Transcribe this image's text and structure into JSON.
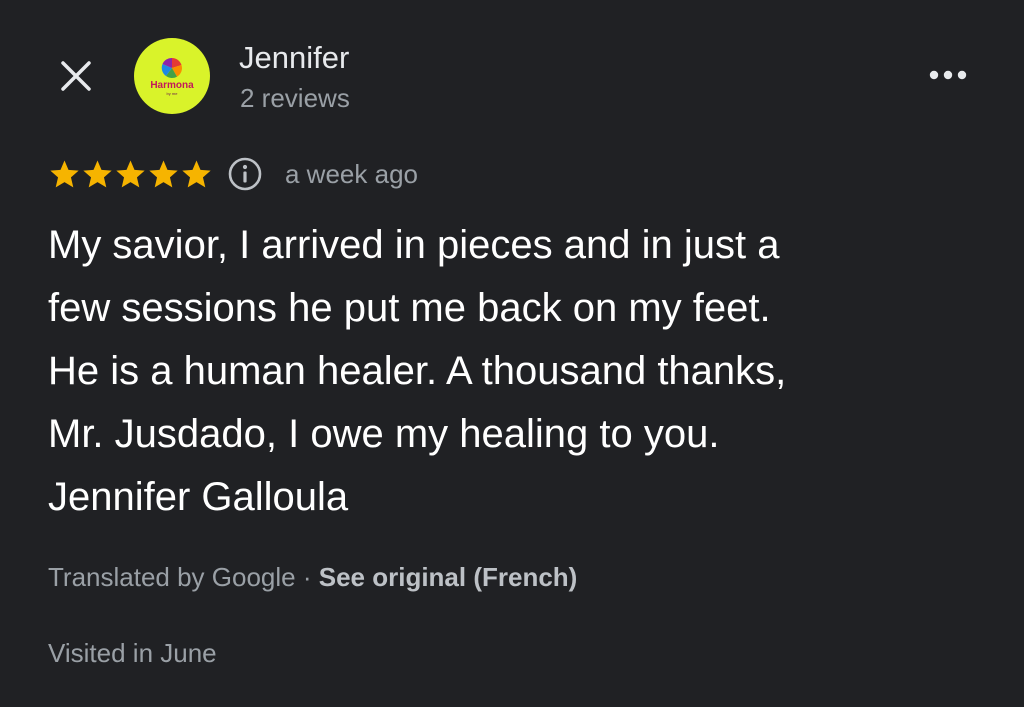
{
  "header": {
    "reviewer_name": "Jennifer",
    "reviewer_meta": "2 reviews",
    "avatar": {
      "brand": "Harmona",
      "brand_sub": "by me",
      "background_color": "#d9f32a"
    },
    "close_icon": "close-icon",
    "more_icon": "more-horizontal-icon"
  },
  "rating": {
    "stars": 5,
    "max_stars": 5,
    "star_color": "#f6b400",
    "info_icon": "info-icon",
    "date": "a week ago"
  },
  "review": {
    "lines": [
      "My savior, I arrived in pieces and in just a",
      "few sessions he put me back on my feet.",
      "He is a human healer. A thousand thanks,",
      "Mr. Jusdado, I owe my healing to you.",
      "Jennifer Galloula"
    ]
  },
  "translation": {
    "text": "Translated by Google",
    "separator": " · ",
    "link": "See original (French)"
  },
  "visited": "Visited in June"
}
